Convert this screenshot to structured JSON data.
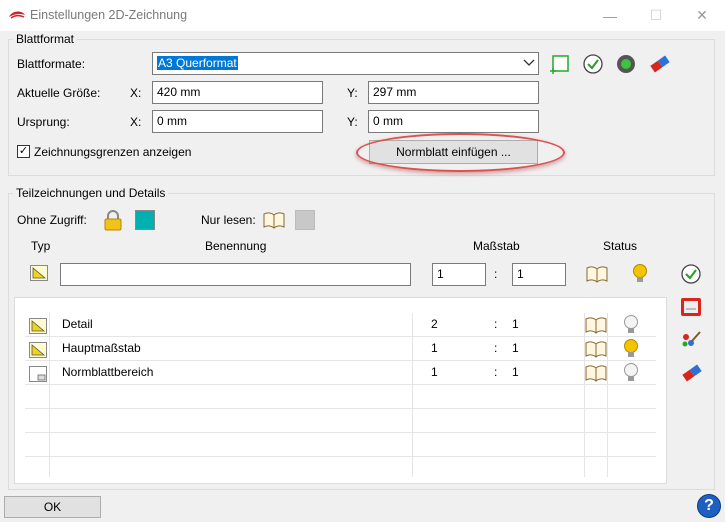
{
  "window": {
    "title": "Einstellungen 2D-Zeichnung",
    "minimize_glyph": "—",
    "maximize_glyph": "☐",
    "close_glyph": "✕"
  },
  "blattformat": {
    "group_title": "Blattformat",
    "formats_label": "Blattformate:",
    "formats_value": "A3 Querformat",
    "size_label": "Aktuelle Größe:",
    "size_x_label": "X:",
    "size_x_value": "420 mm",
    "size_y_label": "Y:",
    "size_y_value": "297 mm",
    "origin_label": "Ursprung:",
    "origin_x_label": "X:",
    "origin_x_value": "0 mm",
    "origin_y_label": "Y:",
    "origin_y_value": "0 mm",
    "show_borders_label": "Zeichnungsgrenzen anzeigen",
    "show_borders_checked": true,
    "insert_button": "Normblatt einfügen ..."
  },
  "teilzeichnungen": {
    "group_title": "Teilzeichnungen und Details",
    "no_access_label": "Ohne Zugriff:",
    "read_only_label": "Nur lesen:",
    "col_type": "Typ",
    "col_name": "Benennung",
    "col_scale": "Maßstab",
    "col_status": "Status",
    "new_name_value": "",
    "new_scale_a": "1",
    "new_scale_sep": ":",
    "new_scale_b": "1",
    "rows": [
      {
        "name": "Detail",
        "scale_a": "2",
        "sep": ":",
        "scale_b": "1",
        "icon": "detail-icon",
        "lamp": "off"
      },
      {
        "name": "Hauptmaßstab",
        "scale_a": "1",
        "sep": ":",
        "scale_b": "1",
        "icon": "detail-icon",
        "lamp": "on"
      },
      {
        "name": "Normblattbereich",
        "scale_a": "1",
        "sep": ":",
        "scale_b": "1",
        "icon": "sheet-icon",
        "lamp": "off"
      }
    ]
  },
  "footer": {
    "ok_label": "OK",
    "help_glyph": "?"
  },
  "colors": {
    "accent": "#0078d7",
    "teal": "#00b0b0",
    "highlight": "#d9534f",
    "lamp_on": "#f5c400"
  }
}
